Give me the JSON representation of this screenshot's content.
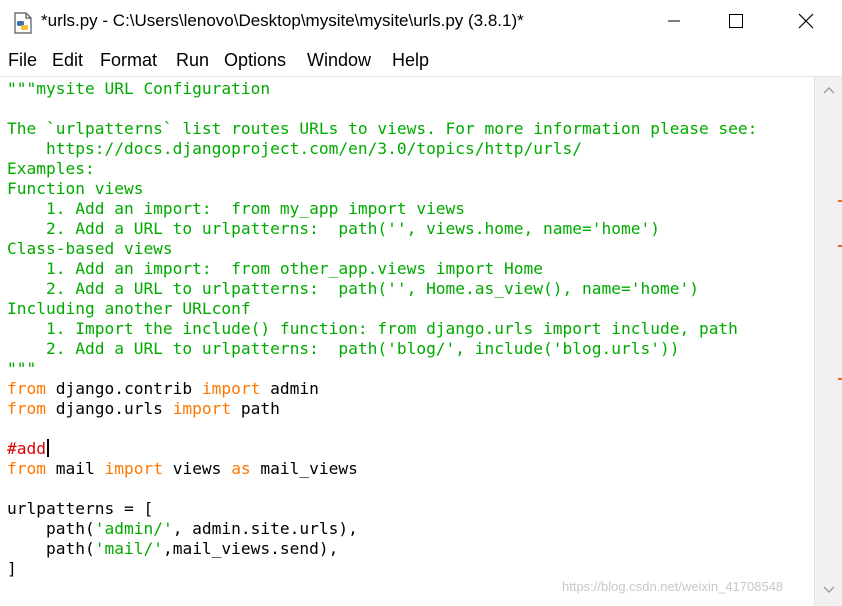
{
  "window": {
    "title": "*urls.py - C:\\Users\\lenovo\\Desktop\\mysite\\mysite\\urls.py (3.8.1)*",
    "controls": {
      "minimize_icon": "minimize-icon",
      "maximize_icon": "maximize-icon",
      "close_icon": "close-icon"
    }
  },
  "menu": {
    "items": [
      {
        "label": "File"
      },
      {
        "label": "Edit"
      },
      {
        "label": "Format"
      },
      {
        "label": "Run"
      },
      {
        "label": "Options"
      },
      {
        "label": "Window"
      },
      {
        "label": "Help"
      }
    ]
  },
  "editor": {
    "lines": [
      [
        {
          "t": "\"\"\"mysite URL Configuration",
          "c": "str"
        }
      ],
      [
        {
          "t": "",
          "c": "str"
        }
      ],
      [
        {
          "t": "The `urlpatterns` list routes URLs to views. For more information please see:",
          "c": "str"
        }
      ],
      [
        {
          "t": "    https://docs.djangoproject.com/en/3.0/topics/http/urls/",
          "c": "str"
        }
      ],
      [
        {
          "t": "Examples:",
          "c": "str"
        }
      ],
      [
        {
          "t": "Function views",
          "c": "str"
        }
      ],
      [
        {
          "t": "    1. Add an import:  from my_app import views",
          "c": "str"
        }
      ],
      [
        {
          "t": "    2. Add a URL to urlpatterns:  path('', views.home, name='home')",
          "c": "str"
        }
      ],
      [
        {
          "t": "Class-based views",
          "c": "str"
        }
      ],
      [
        {
          "t": "    1. Add an import:  from other_app.views import Home",
          "c": "str"
        }
      ],
      [
        {
          "t": "    2. Add a URL to urlpatterns:  path('', Home.as_view(), name='home')",
          "c": "str"
        }
      ],
      [
        {
          "t": "Including another URLconf",
          "c": "str"
        }
      ],
      [
        {
          "t": "    1. Import the include() function: from django.urls import include, path",
          "c": "str"
        }
      ],
      [
        {
          "t": "    2. Add a URL to urlpatterns:  path('blog/', include('blog.urls'))",
          "c": "str"
        }
      ],
      [
        {
          "t": "\"\"\"",
          "c": "str"
        }
      ],
      [
        {
          "t": "from",
          "c": "kw"
        },
        {
          "t": " django.contrib ",
          "c": ""
        },
        {
          "t": "import",
          "c": "kw"
        },
        {
          "t": " admin",
          "c": ""
        }
      ],
      [
        {
          "t": "from",
          "c": "kw"
        },
        {
          "t": " django.urls ",
          "c": ""
        },
        {
          "t": "import",
          "c": "kw"
        },
        {
          "t": " path",
          "c": ""
        }
      ],
      [
        {
          "t": "",
          "c": ""
        }
      ],
      [
        {
          "t": "#add",
          "c": "cm"
        },
        {
          "t": "",
          "c": "cursor"
        }
      ],
      [
        {
          "t": "from",
          "c": "kw"
        },
        {
          "t": " mail ",
          "c": ""
        },
        {
          "t": "import",
          "c": "kw"
        },
        {
          "t": " views ",
          "c": ""
        },
        {
          "t": "as",
          "c": "kw"
        },
        {
          "t": " mail_views",
          "c": ""
        }
      ],
      [
        {
          "t": "",
          "c": ""
        }
      ],
      [
        {
          "t": "urlpatterns = [",
          "c": ""
        }
      ],
      [
        {
          "t": "    path(",
          "c": ""
        },
        {
          "t": "'admin/'",
          "c": "str"
        },
        {
          "t": ", admin.site.urls),",
          "c": ""
        }
      ],
      [
        {
          "t": "    path(",
          "c": ""
        },
        {
          "t": "'mail/'",
          "c": "str"
        },
        {
          "t": ",mail_views.send),",
          "c": ""
        }
      ],
      [
        {
          "t": "]",
          "c": ""
        }
      ]
    ]
  },
  "scrollbar": {
    "up_icon": "chevron-up-icon",
    "down_icon": "chevron-down-icon"
  },
  "watermark": "https://blog.csdn.net/weixin_41708548",
  "colors": {
    "string": "#00aa00",
    "keyword": "#ff7700",
    "comment": "#dd0000",
    "text": "#000000"
  }
}
